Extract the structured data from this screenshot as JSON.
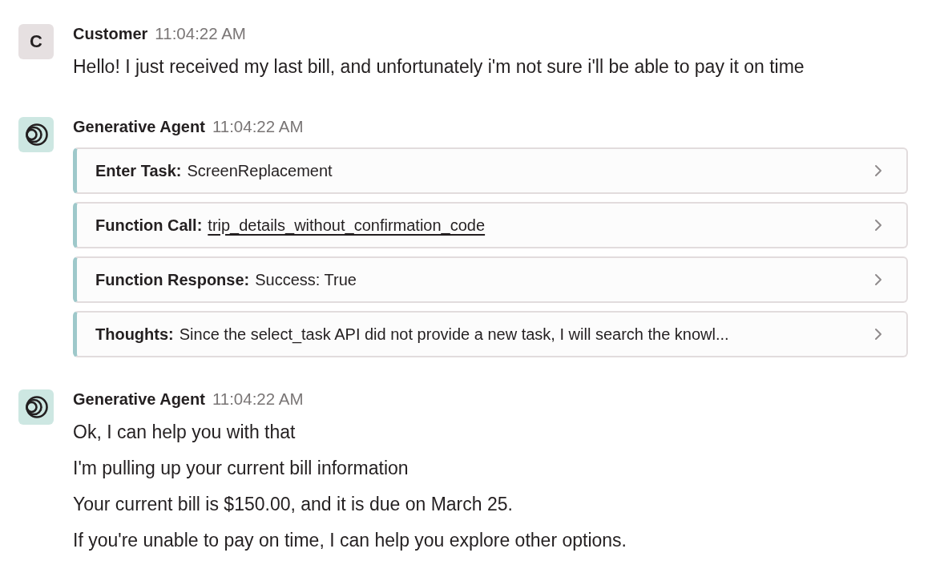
{
  "messages": [
    {
      "kind": "customer",
      "avatar": "C",
      "sender": "Customer",
      "time": "11:04:22 AM",
      "lines": [
        "Hello! I just received my last bill, and unfortunately i'm not sure i'll be able to pay it on time"
      ]
    },
    {
      "kind": "agent",
      "sender": "Generative Agent",
      "time": "11:04:22 AM",
      "steps": [
        {
          "label": "Enter Task:",
          "value": "ScreenReplacement",
          "link": false,
          "expanded": false
        },
        {
          "label": "Function Call:",
          "value": "trip_details_without_confirmation_code",
          "link": true,
          "expanded": false
        },
        {
          "label": "Function Response:",
          "value": "Success: True",
          "link": false,
          "expanded": false
        },
        {
          "label": "Thoughts:",
          "value": "Since the select_task API did not provide a new task, I will search the knowl...",
          "link": false,
          "expanded": false
        }
      ]
    },
    {
      "kind": "agent",
      "sender": "Generative Agent",
      "time": "11:04:22 AM",
      "lines": [
        "Ok, I can help you with that",
        "I'm pulling up your current bill information",
        "Your current bill is $150.00, and it is due on March 25.",
        "If you're unable to pay on time, I can help you explore other options."
      ]
    }
  ]
}
